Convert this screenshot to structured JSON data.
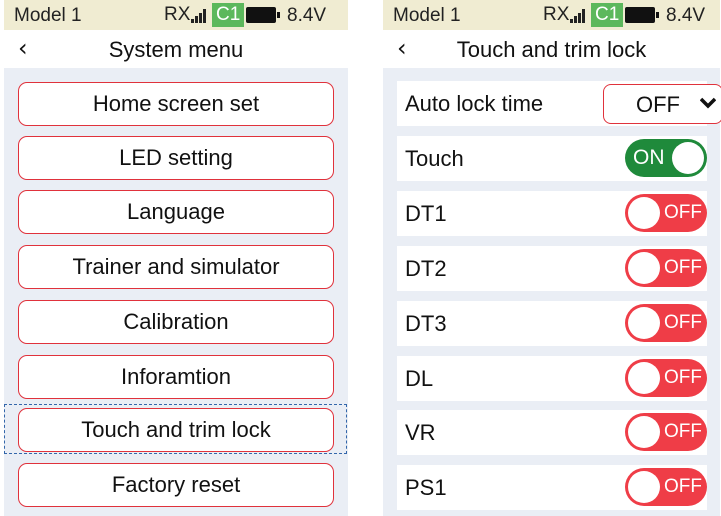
{
  "status": {
    "model": "Model 1",
    "rx": "RX",
    "channel": "C1",
    "voltage": "8.4V",
    "colors": {
      "channel_bg": "#5cb85c",
      "bar_bg": "#f0ecd2"
    }
  },
  "system_menu": {
    "title": "System menu",
    "items": [
      {
        "label": "Home screen set"
      },
      {
        "label": "LED setting"
      },
      {
        "label": "Language"
      },
      {
        "label": "Trainer and simulator"
      },
      {
        "label": "Calibration"
      },
      {
        "label": "Inforamtion"
      },
      {
        "label": "Touch and trim lock"
      },
      {
        "label": "Factory reset"
      }
    ],
    "selected_index": 6
  },
  "lock_screen": {
    "title": "Touch and trim lock",
    "auto_lock": {
      "label": "Auto lock time",
      "value": "OFF"
    },
    "switches": [
      {
        "label": "Touch",
        "state": "ON"
      },
      {
        "label": "DT1",
        "state": "OFF"
      },
      {
        "label": "DT2",
        "state": "OFF"
      },
      {
        "label": "DT3",
        "state": "OFF"
      },
      {
        "label": "DL",
        "state": "OFF"
      },
      {
        "label": "VR",
        "state": "OFF"
      },
      {
        "label": "PS1",
        "state": "OFF"
      }
    ]
  },
  "colors": {
    "accent": "#e0323c",
    "on": "#1f8a3b",
    "off": "#ef3d47",
    "screen_bg": "#eaeef5"
  }
}
